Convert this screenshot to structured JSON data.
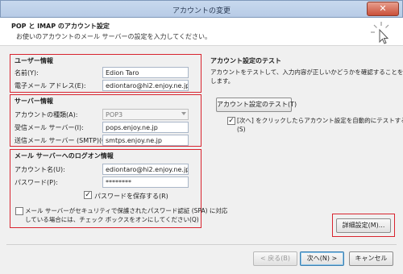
{
  "window": {
    "title": "アカウントの変更",
    "close_glyph": "✕"
  },
  "header": {
    "title": "POP と IMAP のアカウント設定",
    "subtitle": "お使いのアカウントのメール サーバーの設定を入力してください。"
  },
  "user_info": {
    "section_title": "ユーザー情報",
    "name_label": "名前(Y):",
    "name_value": "Edion Taro",
    "email_label": "電子メール アドレス(E):",
    "email_value": "ediontaro@hi2.enjoy.ne.jp"
  },
  "server_info": {
    "section_title": "サーバー情報",
    "account_type_label": "アカウントの種類(A):",
    "account_type_value": "POP3",
    "incoming_label": "受信メール サーバー(I):",
    "incoming_value": "pops.enjoy.ne.jp",
    "outgoing_label": "送信メール サーバー (SMTP)(O):",
    "outgoing_value": "smtps.enjoy.ne.jp"
  },
  "logon_info": {
    "section_title": "メール サーバーへのログオン情報",
    "account_name_label": "アカウント名(U):",
    "account_name_value": "ediontaro@hi2.enjoy.ne.jp",
    "password_label": "パスワード(P):",
    "password_value": "********",
    "remember_password_label": "パスワードを保存する(R)",
    "remember_password_checked": true,
    "spa_label_line1": "メール サーバーがセキュリティで保護されたパスワード認証 (SPA) に対応",
    "spa_label_line2": "している場合には、チェック ボックスをオンにしてください(Q)",
    "spa_checked": false
  },
  "test": {
    "section_title": "アカウント設定のテスト",
    "description_line1": "アカウントをテストして、入力内容が正しいかどうかを確認することをお勧め",
    "description_line2": "します。",
    "test_button": "アカウント設定のテスト(T)",
    "auto_test_label_line1": "[次へ] をクリックしたらアカウント設定を自動的にテストする",
    "auto_test_label_line2": "(S)",
    "auto_test_checked": true,
    "more_settings_button": "詳細設定(M)..."
  },
  "footer": {
    "back_button": "< 戻る(B)",
    "next_button": "次へ(N) >",
    "cancel_button": "キャンセル"
  },
  "icons": {
    "header_icon": "cursor-click-icon",
    "checkmark": "✓"
  },
  "colors": {
    "highlight_border": "#d8242f",
    "title_bar": "#b7cbe6",
    "dialog_bg": "#f0f0f0"
  }
}
